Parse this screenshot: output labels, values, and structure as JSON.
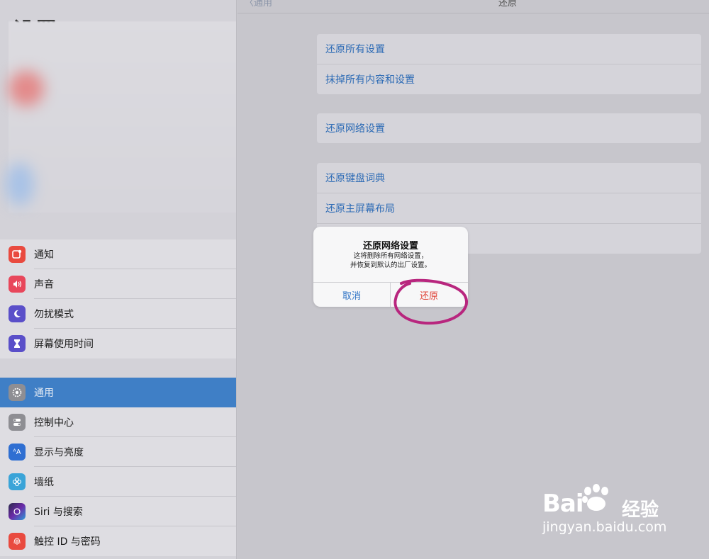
{
  "sidebar": {
    "title": "设置",
    "group1": [
      {
        "label": "通知",
        "icon": "notification-icon",
        "color": "#e94a3f"
      },
      {
        "label": "声音",
        "icon": "speaker-icon",
        "color": "#e8475b"
      },
      {
        "label": "勿扰模式",
        "icon": "moon-icon",
        "color": "#5a4fc9"
      },
      {
        "label": "屏幕使用时间",
        "icon": "hourglass-icon",
        "color": "#5a4fc9"
      }
    ],
    "group2": [
      {
        "label": "通用",
        "icon": "gear-icon",
        "color": "#8e8e93",
        "selected": true
      },
      {
        "label": "控制中心",
        "icon": "toggles-icon",
        "color": "#8e8e93"
      },
      {
        "label": "显示与亮度",
        "icon": "text-size-icon",
        "color": "#2f6fd2"
      },
      {
        "label": "墙纸",
        "icon": "flower-icon",
        "color": "#3aa4d8"
      },
      {
        "label": "Siri 与搜索",
        "icon": "siri-icon",
        "color": "#222"
      },
      {
        "label": "触控 ID 与密码",
        "icon": "fingerprint-icon",
        "color": "#e94a3f"
      }
    ]
  },
  "nav": {
    "back_label": "通用",
    "title": "还原"
  },
  "reset": {
    "card1": [
      "还原所有设置",
      "抹掉所有内容和设置"
    ],
    "card2": [
      "还原网络设置"
    ],
    "card3": [
      "还原键盘词典",
      "还原主屏幕布局",
      ""
    ]
  },
  "alert": {
    "title": "还原网络设置",
    "message_line1": "这将删除所有网络设置，",
    "message_line2": "并恢复到默认的出厂设置。",
    "cancel_label": "取消",
    "confirm_label": "还原"
  },
  "watermark": {
    "brand": "Bai",
    "brand_suffix": "经验",
    "url": "jingyan.baidu.com"
  },
  "colors": {
    "accent": "#2e73c5",
    "destructive": "#e0463a",
    "annotation": "#b8267e",
    "selection": "#3f7fc6"
  }
}
